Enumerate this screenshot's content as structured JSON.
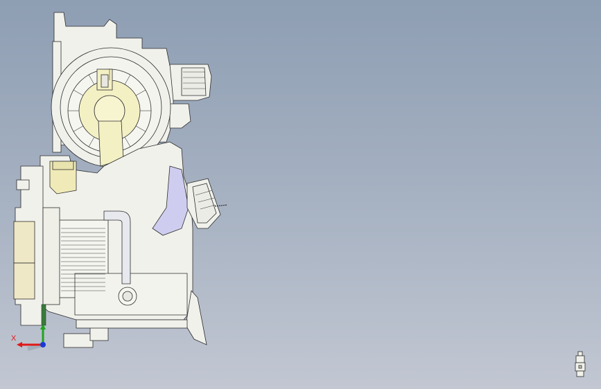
{
  "viewport": {
    "background_top": "#8e9eb3",
    "background_bottom": "#c2c7d2"
  },
  "model": {
    "line_color": "#2b2b2b",
    "body_fill": "#f1f1ec",
    "accent_yellow": "#f3f0c4",
    "accent_blue": "#c8c8ef",
    "accent_green": "#3a7a3a"
  },
  "triad": {
    "x_label": "X",
    "x_color": "#e01818",
    "y_color": "#1ea51e",
    "z_color": "#1a3ad8"
  },
  "view_cube": {
    "icon": "orientation-figure-icon"
  }
}
